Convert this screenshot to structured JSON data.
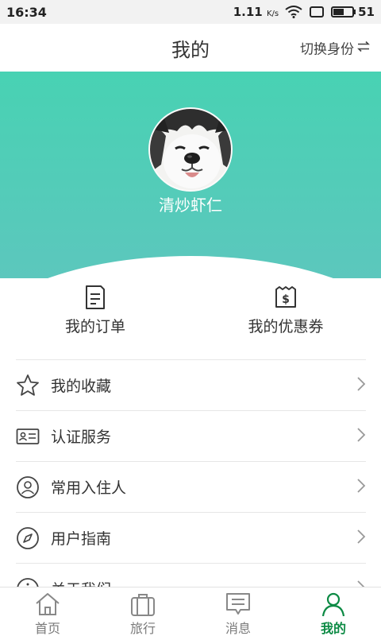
{
  "status_bar": {
    "time": "16:34",
    "net_speed": "1.11",
    "net_unit": "K/s",
    "battery": "51",
    "icons": [
      "wifi-icon",
      "screen-icon",
      "battery-icon"
    ]
  },
  "header": {
    "title": "我的",
    "switch_label": "切换身份",
    "switch_icon": "swap-icon"
  },
  "profile": {
    "username": "清炒虾仁",
    "accent": "#48d2b3"
  },
  "quick_actions": [
    {
      "label": "我的订单",
      "icon": "order-icon"
    },
    {
      "label": "我的优惠券",
      "icon": "coupon-icon"
    }
  ],
  "menu": [
    {
      "label": "我的收藏",
      "icon": "star-icon"
    },
    {
      "label": "认证服务",
      "icon": "id-card-icon"
    },
    {
      "label": "常用入住人",
      "icon": "person-icon"
    },
    {
      "label": "用户指南",
      "icon": "compass-icon"
    },
    {
      "label": "关于我们",
      "icon": "info-icon"
    }
  ],
  "bottom_nav": {
    "active": "我的",
    "active_color": "#0c8a44",
    "items": [
      {
        "label": "首页",
        "icon": "home-icon"
      },
      {
        "label": "旅行",
        "icon": "suitcase-icon"
      },
      {
        "label": "消息",
        "icon": "message-icon"
      },
      {
        "label": "我的",
        "icon": "user-icon"
      }
    ]
  }
}
